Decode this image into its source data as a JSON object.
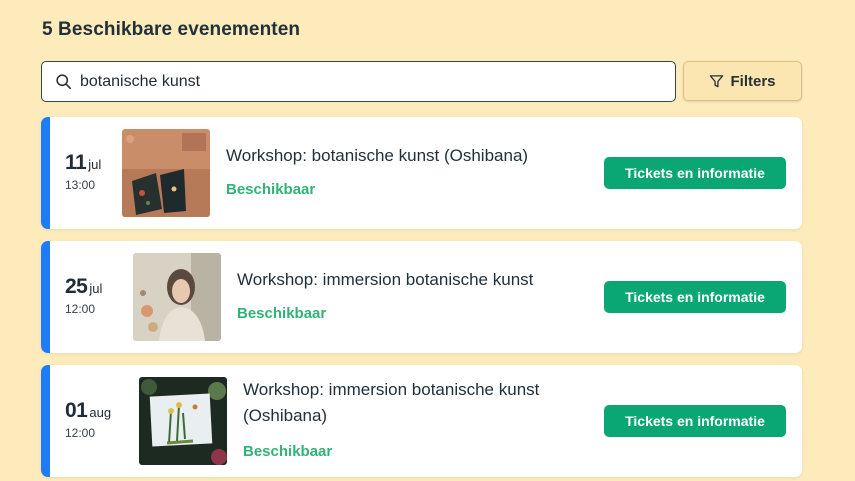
{
  "heading": "5 Beschikbare evenementen",
  "search": {
    "value": "botanische kunst",
    "icon": "search-icon"
  },
  "filters": {
    "label": "Filters",
    "icon": "filter-icon"
  },
  "accent": "#1e7cf7",
  "button_color": "#0aa775",
  "status_color": "#33b277",
  "events": [
    {
      "day": "11",
      "month": "jul",
      "time": "13:00",
      "title": "Workshop: botanische kunst (Oshibana)",
      "status": "Beschikbaar",
      "button": "Tickets en informatie"
    },
    {
      "day": "25",
      "month": "jul",
      "time": "12:00",
      "title": "Workshop: immersion botanische kunst",
      "status": "Beschikbaar",
      "button": "Tickets en informatie"
    },
    {
      "day": "01",
      "month": "aug",
      "time": "12:00",
      "title": "Workshop: immersion botanische kunst (Oshibana)",
      "status": "Beschikbaar",
      "button": "Tickets en informatie"
    }
  ]
}
